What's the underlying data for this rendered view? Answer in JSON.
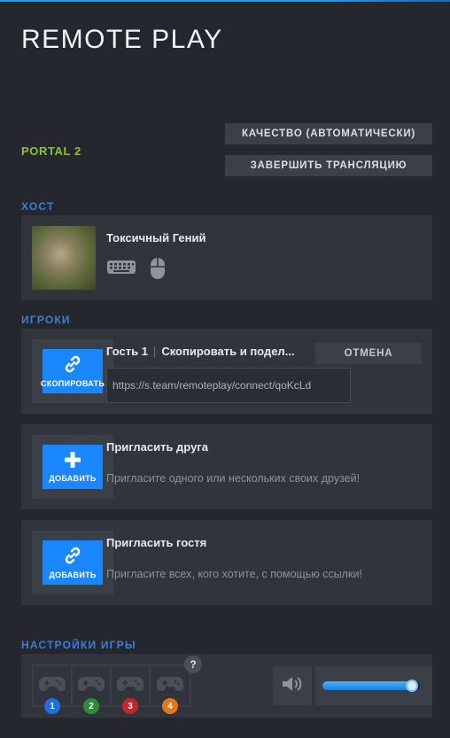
{
  "app": {
    "title": "REMOTE PLAY"
  },
  "game": {
    "name": "PORTAL 2"
  },
  "buttons": {
    "quality": "КАЧЕСТВО (АВТОМАТИЧЕСКИ)",
    "end_stream": "ЗАВЕРШИТЬ ТРАНСЛЯЦИЮ"
  },
  "host": {
    "section_label": "ХОСТ",
    "name": "Токсичный Гений",
    "devices": [
      "keyboard-icon",
      "mouse-icon"
    ]
  },
  "players": {
    "section_label": "ИГРОКИ",
    "guest_invite": {
      "action_label": "СКОПИРОВАТЬ",
      "guest_name": "Гость 1",
      "instruction": "Скопировать и подел...",
      "cancel_label": "ОТМЕНА",
      "link": "https://s.team/remoteplay/connect/qoKcLd"
    },
    "invite_friend": {
      "action_label": "ДОБАВИТЬ",
      "title": "Пригласить друга",
      "subtitle": "Пригласите одного или нескольких своих друзей!"
    },
    "invite_guest": {
      "action_label": "ДОБАВИТЬ",
      "title": "Пригласить гостя",
      "subtitle": "Пригласите всех, кого хотите, с помощью ссылки!"
    }
  },
  "game_settings": {
    "section_label": "НАСТРОЙКИ ИГРЫ",
    "help": "?",
    "controller_slots": [
      {
        "number": "1",
        "color": "#1f6fe0"
      },
      {
        "number": "2",
        "color": "#2e8b3a"
      },
      {
        "number": "3",
        "color": "#c0282d"
      },
      {
        "number": "4",
        "color": "#e07a1f"
      }
    ],
    "volume_level": 0.93
  },
  "colors": {
    "accent_blue": "#1a87ff",
    "game_green": "#8fbf3a",
    "section_blue": "#3d7fd4"
  }
}
